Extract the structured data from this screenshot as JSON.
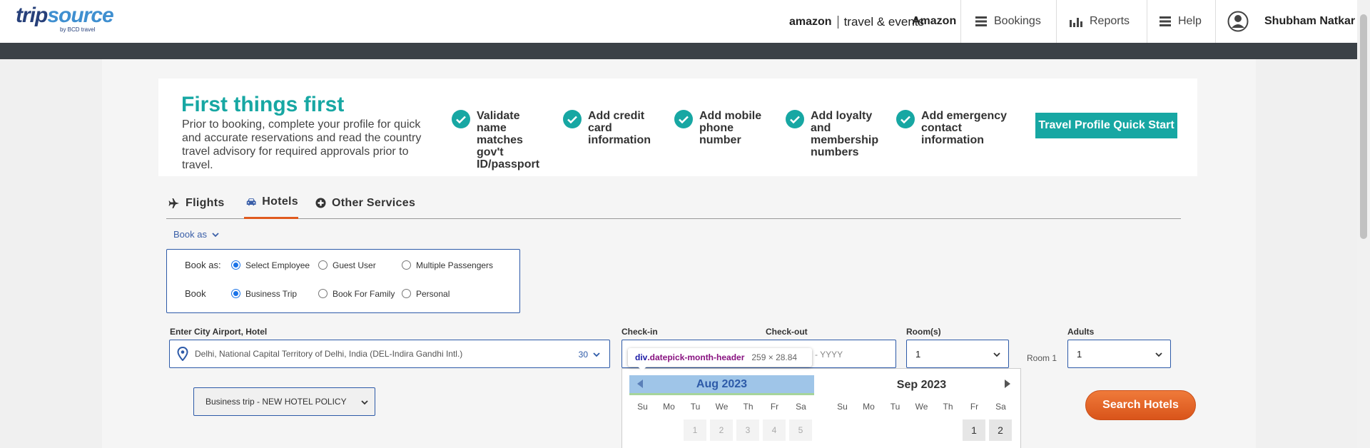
{
  "nav": {
    "logo_text_trip": "trip",
    "logo_text_source": "source",
    "logo_byline": "by BCD travel",
    "amazon_logo": "amazon",
    "amazon_suffix": "travel & events",
    "company": "Amazon",
    "bookings": "Bookings",
    "reports": "Reports",
    "help": "Help",
    "user_name": "Shubham Natkar"
  },
  "banner": {
    "title": "First things first",
    "description": "Prior to booking, complete your profile for quick and accurate reservations and read the country travel advisory for required approvals prior to travel.",
    "checks": [
      "Validate name matches gov't ID/passport",
      "Add credit card information",
      "Add mobile phone number",
      "Add loyalty and membership numbers",
      "Add emergency contact information"
    ],
    "cta": "Travel Profile Quick Start"
  },
  "tabs": {
    "flights": "Flights",
    "hotels": "Hotels",
    "other": "Other Services"
  },
  "book_as_toggle": "Book as",
  "book_box": {
    "row1_label": "Book as:",
    "row1_options": [
      "Select Employee",
      "Guest User",
      "Multiple Passengers"
    ],
    "row2_label": "Book",
    "row2_options": [
      "Business Trip",
      "Book For Family",
      "Personal"
    ]
  },
  "form": {
    "city_label": "Enter City Airport, Hotel",
    "city_value": "Delhi, National Capital Territory of Delhi, India (DEL-Indira Gandhi Intl.)",
    "radius": "30",
    "checkin_label": "Check-in",
    "checkout_label": "Check-out",
    "checkout_placeholder": "- YYYY",
    "rooms_label": "Room(s)",
    "rooms_value": "1",
    "room1_label": "Room 1",
    "adults_label": "Adults",
    "adults_value": "1",
    "policy_value": "Business trip - NEW HOTEL POLICY",
    "search_button": "Search Hotels"
  },
  "tooltip": {
    "tag": "div",
    "cls": ".datepick-month-header",
    "size": "259 × 28.84"
  },
  "datepicker": {
    "month1": "Aug 2023",
    "month2": "Sep 2023",
    "weekdays": [
      "Su",
      "Mo",
      "Tu",
      "We",
      "Th",
      "Fr",
      "Sa"
    ],
    "aug_days": [
      "1",
      "2",
      "3",
      "4",
      "5"
    ],
    "sep_days": [
      "1",
      "2"
    ]
  }
}
